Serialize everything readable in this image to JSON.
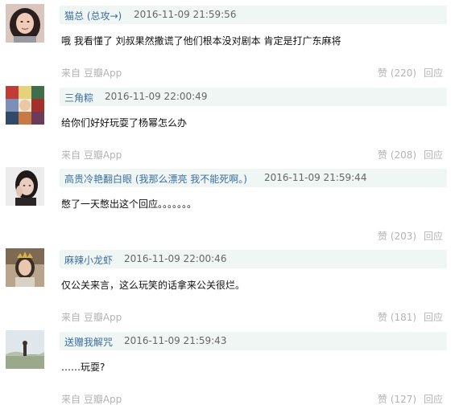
{
  "comments": [
    {
      "user": "猫总 (总攻→)",
      "timestamp": "2016-11-09 21:59:56",
      "text": "哦 我看懂了 刘叔果然撒谎了他们根本没对剧本 肯定是打广东麻将",
      "source": "来自 豆瓣App",
      "likes": "赞 (220)",
      "reply": "回应",
      "avatar": "avatar-woman-dark-hair"
    },
    {
      "user": "三角粽",
      "timestamp": "2016-11-09 22:00:49",
      "text": "给你们好好玩耍了杨幂怎么办",
      "source": "来自 豆瓣App",
      "likes": "赞 (208)",
      "reply": "回应",
      "avatar": "avatar-colorful-collage"
    },
    {
      "user": "高贵冷艳翻白眼 (我那么漂亮 我不能死啊。)",
      "timestamp": "2016-11-09 21:59:44",
      "text": "憋了一天憋出这个回应。。。。。。。",
      "source": "",
      "likes": "赞 (203)",
      "reply": "回应",
      "avatar": "avatar-girl-hand-on-face"
    },
    {
      "user": "麻辣小龙虾",
      "timestamp": "2016-11-09 22:00:46",
      "text": "仅公关来言，这么玩笑的话拿来公关很烂。",
      "source": "来自 豆瓣App",
      "likes": "赞 (181)",
      "reply": "回应",
      "avatar": "avatar-crowned-woman"
    },
    {
      "user": "送赠我解咒",
      "timestamp": "2016-11-09 21:59:43",
      "text": "……玩耍?",
      "source": "来自 豆瓣App",
      "likes": "赞 (127)",
      "reply": "回应",
      "avatar": "avatar-landscape-figure"
    }
  ]
}
